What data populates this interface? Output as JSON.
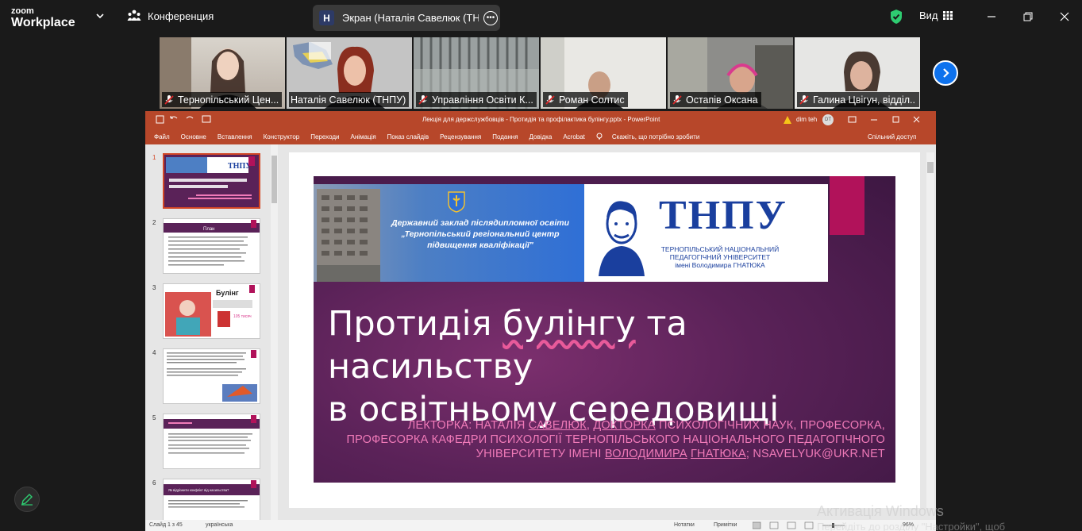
{
  "zoom": {
    "logo_small": "zoom",
    "logo_big": "Workplace",
    "meeting_label": "Конференция",
    "share_badge": "Н",
    "share_label": "Экран (Наталія Савелюк (ТНПУ",
    "view_label": "Вид",
    "shield_color": "#2ecc71",
    "accent": "#0e72ed"
  },
  "participants": [
    {
      "name": "Тернопільський Цен...",
      "muted": true
    },
    {
      "name": "Наталія Савелюк (ТНПУ)",
      "muted": false,
      "active": true
    },
    {
      "name": "Управління Освіти К...",
      "muted": true
    },
    {
      "name": "Роман Солтис",
      "muted": true
    },
    {
      "name": "Остапів Оксана",
      "muted": true
    },
    {
      "name": "Галина Цвігун, відділ...",
      "muted": true
    }
  ],
  "ppt": {
    "doc_title": "Лекція для держслужбовців - Протидія та профілактика булінгу.pptx  -  PowerPoint",
    "user": "dim teh",
    "user_initials": "DT",
    "menu": [
      "Файл",
      "Основне",
      "Вставлення",
      "Конструктор",
      "Переходи",
      "Анімація",
      "Показ слайдів",
      "Рецензування",
      "Подання",
      "Довідка",
      "Acrobat"
    ],
    "tell_me": "Скажіть, що потрібно зробити",
    "share": "Спільний доступ",
    "thumbs": [
      "1",
      "2",
      "3",
      "4",
      "5",
      "6"
    ],
    "thumb3_title": "Булінг",
    "thumb3_stat": "105 тисяч",
    "thumb2_title": "План",
    "thumb6_title": "Як відрізнити конфлікт від насильства?",
    "status_slide": "Слайд 1 з 45",
    "status_lang": "українська",
    "status_notes": "Нотатки",
    "status_comments": "Примітки",
    "status_zoom": "96%",
    "brand_color": "#b7472a"
  },
  "slide": {
    "banner_line1": "Державний заклад післядипломної освіти",
    "banner_line2": "„Тернопільський регіональний центр",
    "banner_line3": "підвищення кваліфікації\"",
    "tnpu_logo": "ТНПУ",
    "tnpu_sub1": "ТЕРНОПІЛЬСЬКИЙ НАЦІОНАЛЬНИЙ",
    "tnpu_sub2": "ПЕДАГОГІЧНИЙ УНІВЕРСИТЕТ",
    "tnpu_sub3": "імені Володимира ГНАТЮКА",
    "title_a": "Протидія ",
    "title_b": "булінгу",
    "title_c": " та насильству",
    "title_line2": "в освітньому середовищі",
    "author_a": "Лекторка: Наталія ",
    "author_b": "Савелюк",
    "author_c": ", ",
    "author_d": "докторка",
    "author_e": " психологічних наук, професорка,",
    "author_line2": "професорка кафедри психології Тернопільського національного педагогічного",
    "author_f": "університету імені ",
    "author_g": "Володимира",
    "author_h": " ",
    "author_i": "Гнатюка",
    "author_j": "; nsavelyuk@ukr.net"
  },
  "windows": {
    "activation_line1": "Активація Windows",
    "activation_line2": "Перейдіть до розділу \"Настройки\", щоб"
  }
}
